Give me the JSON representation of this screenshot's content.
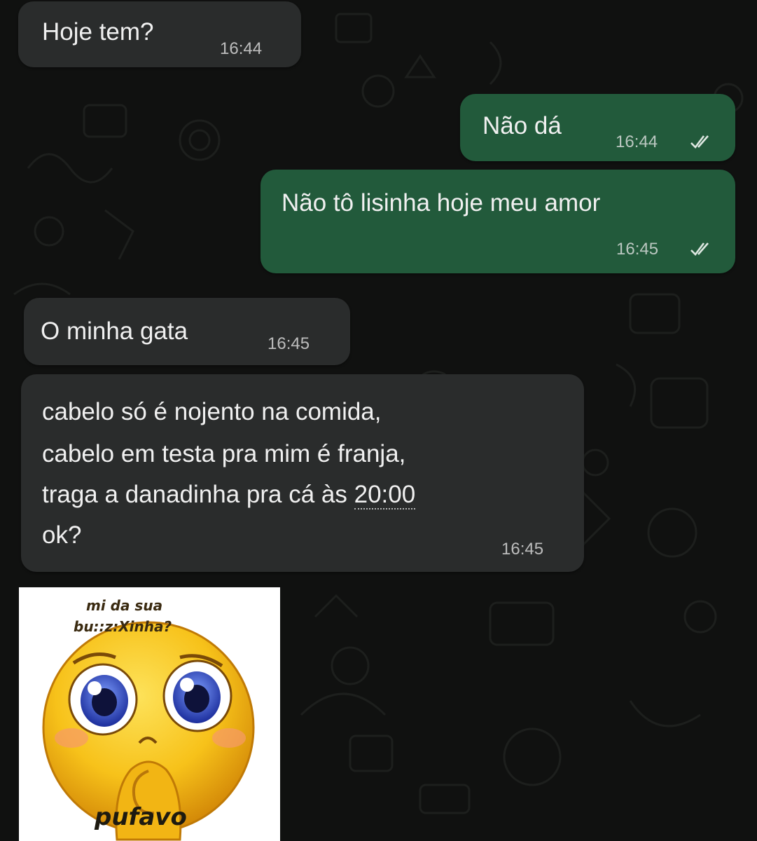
{
  "chat": {
    "messages": [
      {
        "direction": "incoming",
        "text": "Hoje tem?",
        "time": "16:44"
      },
      {
        "direction": "outgoing",
        "text": "Não dá",
        "time": "16:44",
        "status": "read"
      },
      {
        "direction": "outgoing",
        "text": "Não tô lisinha hoje meu amor",
        "time": "16:45",
        "status": "read"
      },
      {
        "direction": "incoming",
        "text": "O minha gata",
        "time": "16:45"
      },
      {
        "direction": "incoming",
        "lines": [
          "cabelo só é nojento na comida,",
          "cabelo em testa pra mim é franja,",
          "traga a danadinha pra cá às ",
          "ok?"
        ],
        "linked_time": "20:00",
        "time": "16:45"
      }
    ],
    "sticker": {
      "top_text_line1": "mi da sua",
      "top_text_line2": "bu::z:Xinha?",
      "bottom_text": "pufavo",
      "face_color": "#f7c21a"
    }
  },
  "colors": {
    "incoming_bubble": "#2a2c2c",
    "outgoing_bubble": "#225a3b",
    "background": "#101110",
    "read_ticks": "#dfe8e2"
  }
}
